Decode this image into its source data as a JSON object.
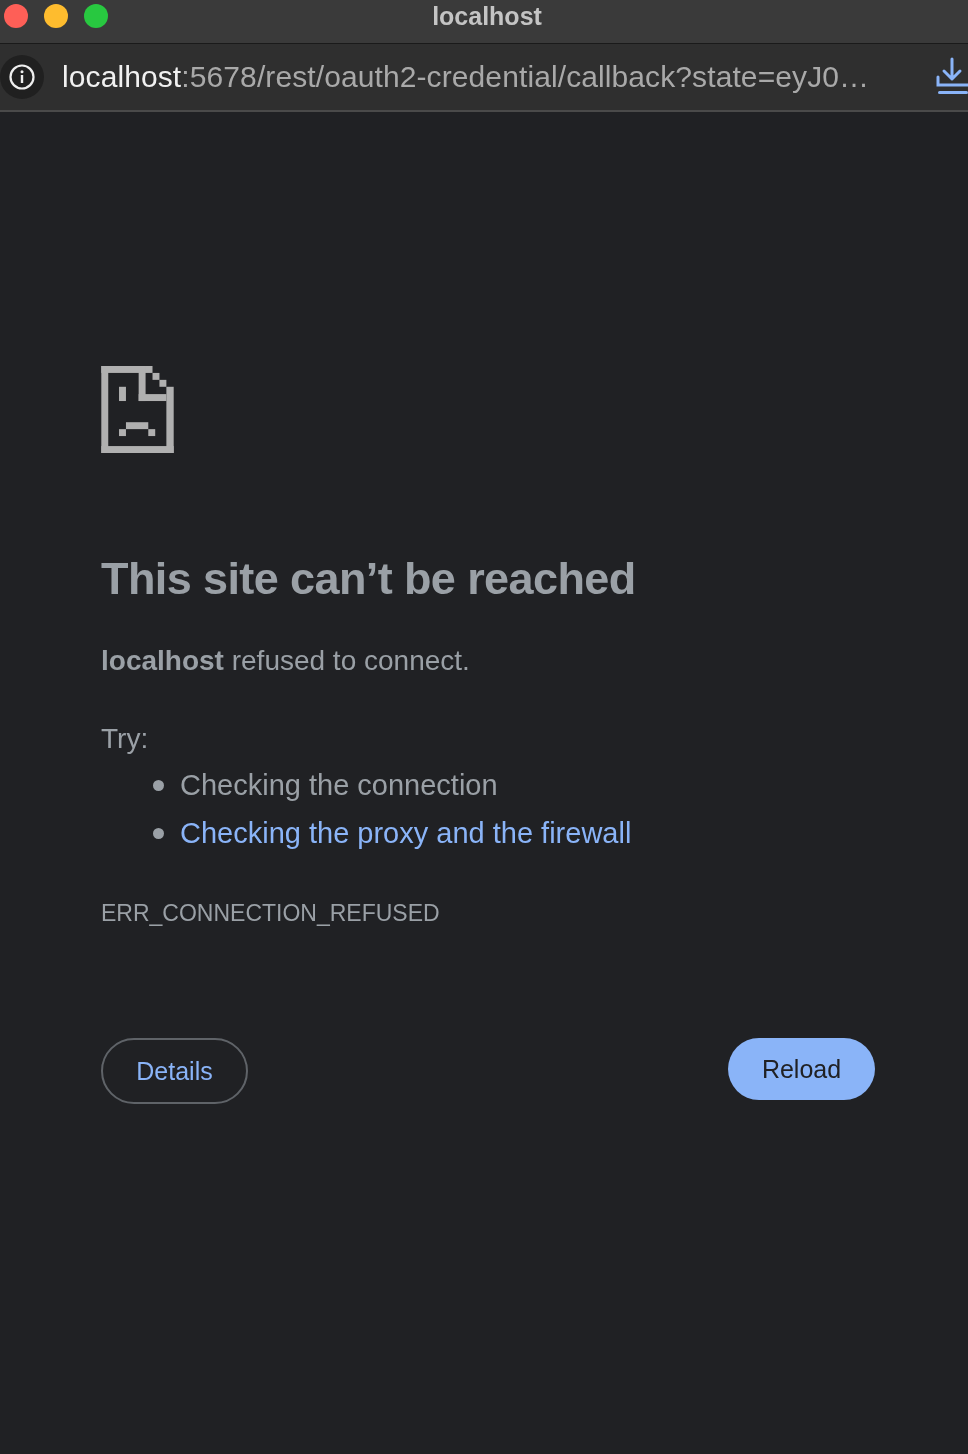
{
  "window": {
    "title": "localhost"
  },
  "address_bar": {
    "url_host": "localhost",
    "url_rest": ":5678/rest/oauth2-credential/callback?state=eyJ0…"
  },
  "error_page": {
    "heading": "This site can’t be reached",
    "message": "**localhost** refused to connect.",
    "try_label": "Try:",
    "suggestions": [
      {
        "text": "Checking the connection",
        "kind": "text"
      },
      {
        "text": "Checking the proxy and the firewall",
        "kind": "link"
      }
    ],
    "error_code": "ERR_CONNECTION_REFUSED",
    "buttons": [
      {
        "label": "Details",
        "kind": "secondary"
      },
      {
        "label": "Reload",
        "kind": "primary"
      }
    ]
  }
}
